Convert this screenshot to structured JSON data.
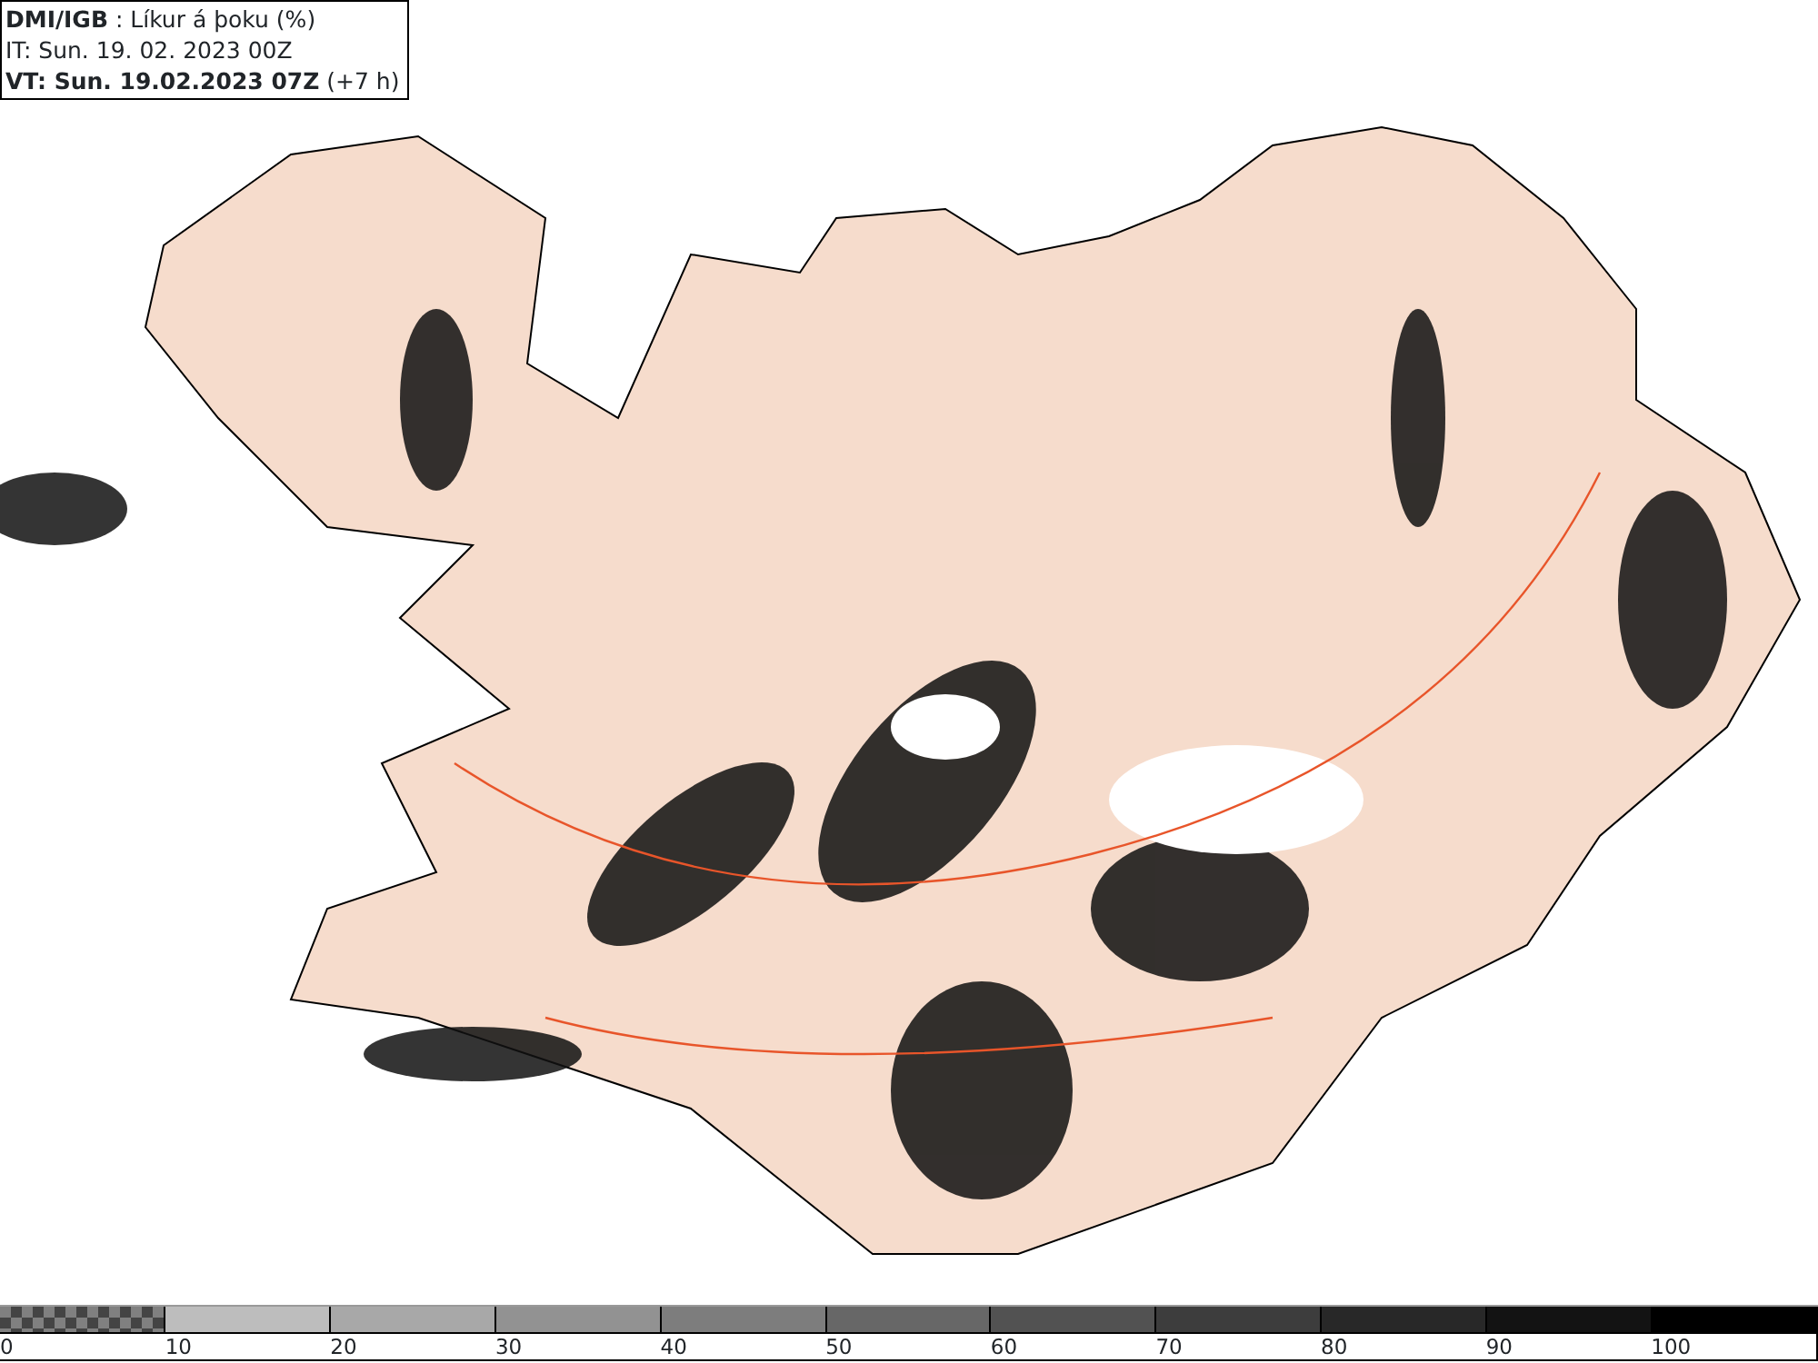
{
  "header": {
    "lines": [
      "**DMI/IGB** : Líkur á þoku (%)",
      "IT: Sun. 19. 02. 2023 00Z",
      "**VT: Sun. 19.02.2023 07Z** (+7 h)"
    ]
  },
  "legend": {
    "segments": [
      {
        "kind": "checker",
        "color": "#808080",
        "label": "0"
      },
      {
        "kind": "solid",
        "color": "#bdbdbd",
        "label": "10"
      },
      {
        "kind": "solid",
        "color": "#a8a8a8",
        "label": "20"
      },
      {
        "kind": "solid",
        "color": "#929292",
        "label": "30"
      },
      {
        "kind": "solid",
        "color": "#7d7d7d",
        "label": "40"
      },
      {
        "kind": "solid",
        "color": "#676767",
        "label": "50"
      },
      {
        "kind": "solid",
        "color": "#525252",
        "label": "60"
      },
      {
        "kind": "solid",
        "color": "#3d3d3d",
        "label": "70"
      },
      {
        "kind": "solid",
        "color": "#282828",
        "label": "80"
      },
      {
        "kind": "solid",
        "color": "#131313",
        "label": "90"
      },
      {
        "kind": "solid",
        "color": "#000000",
        "label": "100"
      }
    ]
  }
}
